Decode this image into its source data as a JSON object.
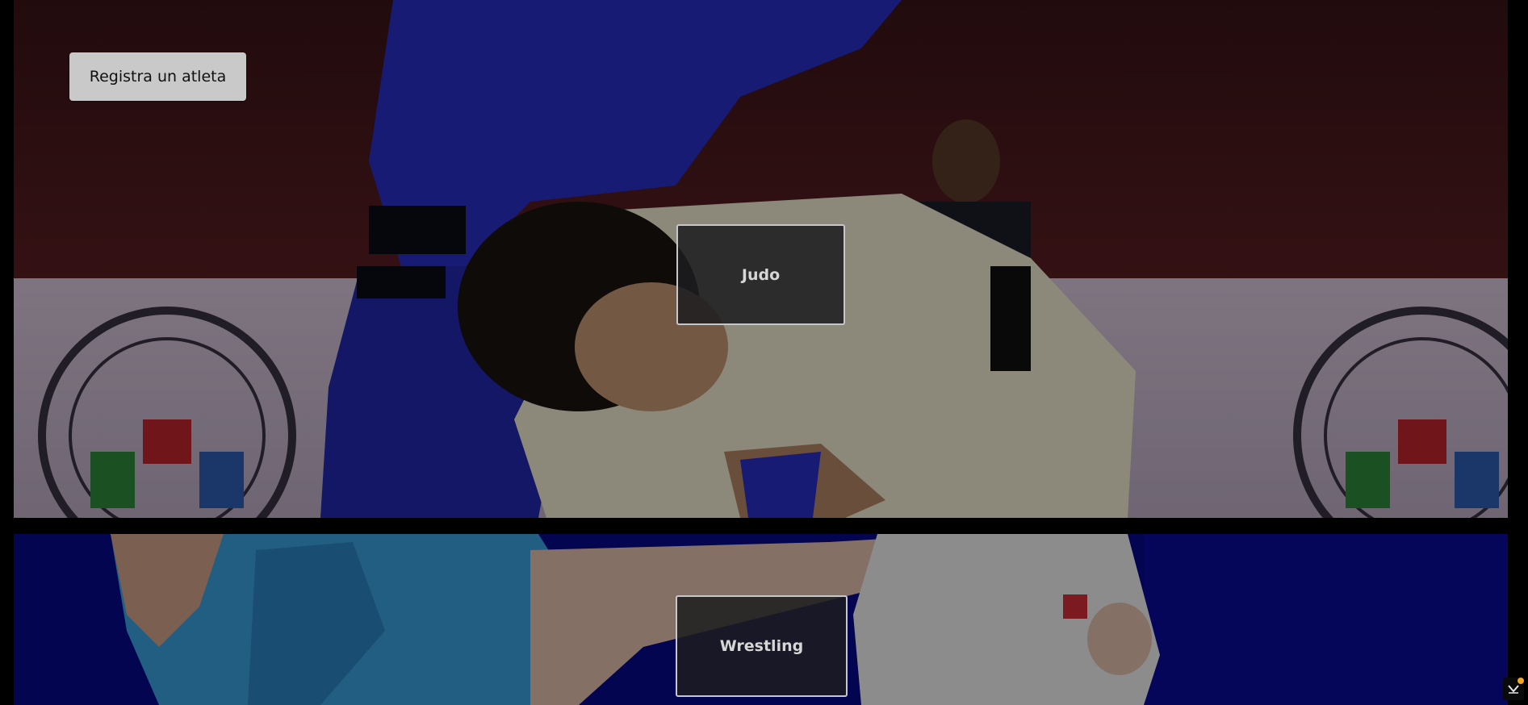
{
  "header": {
    "register_button_label": "Registra un atleta"
  },
  "categories": [
    {
      "label": "Judo"
    },
    {
      "label": "Wrestling"
    }
  ],
  "colors": {
    "page_background": "#000000",
    "tile_border": "#c7c7c7",
    "button_background": "#c9c9c9",
    "notification_dot": "#f5a623"
  },
  "icons": {
    "corner_widget": "chevron-down-icon"
  }
}
